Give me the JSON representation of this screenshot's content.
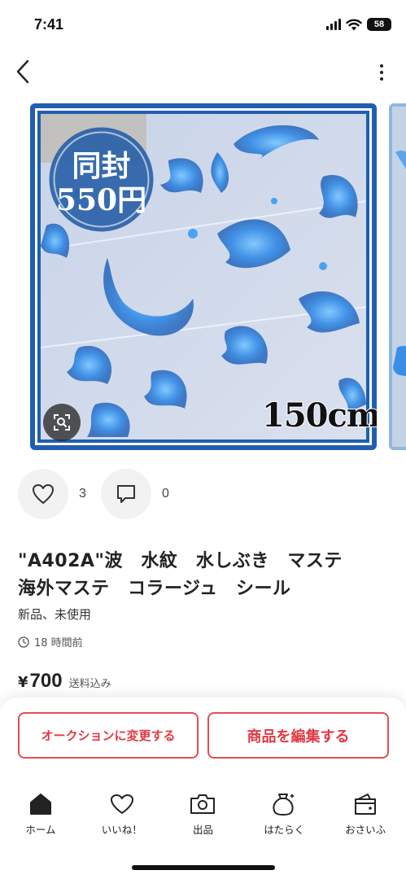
{
  "status_bar": {
    "time": "7:41",
    "battery": "58"
  },
  "product": {
    "image_overlay": {
      "seal_line1": "同封",
      "seal_line2": "550円",
      "length": "150cm"
    },
    "likes": "3",
    "comments": "0",
    "title_line1": "\"A402A\"波　水紋　水しぶき　マステ",
    "title_line2": "海外マステ　コラージュ　シール",
    "condition": "新品、未使用",
    "posted": "18 時間前",
    "price_symbol": "¥",
    "price": "700",
    "shipping": "送料込み"
  },
  "actions": {
    "auction_label": "オークションに変更する",
    "edit_label": "商品を編集する"
  },
  "tab_bar": {
    "items": [
      {
        "label": "ホーム",
        "icon": "home-icon",
        "active": true
      },
      {
        "label": "いいね！",
        "icon": "heart-icon"
      },
      {
        "label": "出品",
        "icon": "camera-icon"
      },
      {
        "label": "はたらく",
        "icon": "money-bag-icon"
      },
      {
        "label": "おさいふ",
        "icon": "wallet-icon"
      }
    ]
  },
  "colors": {
    "accent": "#e64b55",
    "image_frame": "#1f5fae",
    "seal": "#2a62a8"
  }
}
